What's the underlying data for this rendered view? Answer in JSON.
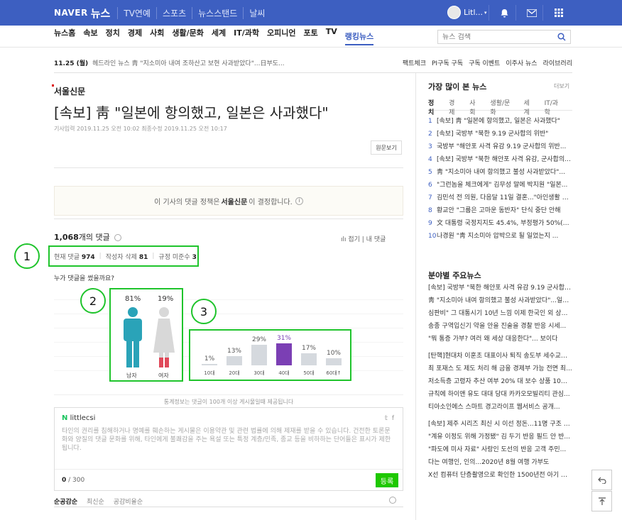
{
  "topbar": {
    "logo": "NAVER",
    "section": "뉴스",
    "links": [
      "TV연예",
      "스포츠",
      "뉴스스탠드",
      "날씨"
    ],
    "user_name": "Litl..."
  },
  "subnav": {
    "items": [
      "뉴스홈",
      "속보",
      "정치",
      "경제",
      "사회",
      "생활/문화",
      "세계",
      "IT/과학",
      "오피니언",
      "포토",
      "TV",
      "랭킹뉴스"
    ],
    "active": "랭킹뉴스",
    "search_placeholder": "뉴스 검색"
  },
  "breaking": {
    "date": "11.25 (월)",
    "text": "헤드라인 뉴스  靑 \"지소미아 내여 조하산고 보현 사과받았다\"...日부도...",
    "links": [
      "팩트체크",
      "PI구독 구독",
      "구독 이벤트",
      "이주사 뉴스",
      "라이브러리"
    ]
  },
  "article": {
    "press": "서울신문",
    "headline": "[속보] 靑 \"일본에 항의했고, 일본은 사과했다\"",
    "meta": "기사입력 2019.11.25 오전 10:02   최종수정 2019.11.25 오전 10:17",
    "origin_button": "원문보기",
    "policy_prefix": "이 기사의 댓글 정책은",
    "policy_press": "서울신문",
    "policy_suffix": "이 결정합니다."
  },
  "comments": {
    "count_number": "1,068",
    "count_suffix": "개의 댓글",
    "right_controls": "ılı 접기  |  내 댓글",
    "stat_current_label": "현재 댓글",
    "stat_current_value": "974",
    "stat_deleted_label": "작성자 삭제",
    "stat_deleted_value": "81",
    "stat_violation_label": "규정 미준수",
    "stat_violation_value": "3",
    "question": "누가 댓글을 썼을까요?",
    "notice": "통계정보는 댓글이 100개 이상 게시물일때 제공됩니다",
    "write_user": "littlecsi",
    "write_placeholder": "타인의 권리를 침해하거나 명예를 훼손하는 게시물은 이용약관 및 관련 법률에 의해 제재를 받을 수 있습니다. 건전한 토론문화와 양질의 댓글 문화를 위해, 타인에게 불쾌감을 주는 욕설 또는 특정 계층/민족, 종교 등을 비하하는 단어들은 표시가 제한됩니다.",
    "char_count": "0",
    "char_max": "/ 300",
    "submit_label": "등록",
    "sort_tabs": [
      "순공감순",
      "최신순",
      "공감비율순"
    ]
  },
  "gender": {
    "male_pct": "81%",
    "female_pct": "19%",
    "male_label": "남자",
    "female_label": "여자",
    "male_color": "#2aa3b8",
    "female_color": "#e0495a"
  },
  "age": {
    "labels": [
      "10대",
      "20대",
      "30대",
      "40대",
      "50대",
      "60대↑"
    ],
    "values": [
      1,
      13,
      29,
      31,
      17,
      10
    ],
    "max_color": "#7b3fb4"
  },
  "ranking": {
    "title": "가장 많이 본 뉴스",
    "more": "더보기",
    "tabs": [
      "정치",
      "경제",
      "사회",
      "생활/문화",
      "세계",
      "IT/과학"
    ],
    "items": [
      "[속보] 靑 \"일본에 항의했고, 일본은 사과했다\"",
      "[속보] 국방부 \"북한 9.19 군사합의 위반\"",
      "국방부 \"해안포 사격 유감 9.19 군사합의 위반...",
      "[속보] 국방부 \"북한 해안포 사격 유감, 군사합의...",
      "靑 \"지소미아 내여 항의했고 불성 사과받았다\"...",
      "\"그런놈을 체크에게\" 김무성 말에 박지원 \"일본...",
      "김민석 전 의원, 다음달 11일 결혼...\"아인생활 발...",
      "황교안 \"그룹은 고마운 동반자\" 단식 중단 안해",
      "文 대통령 국정지지도 45.4%, 부정평가 50%(리...",
      "나경원 \"靑 지소미아 압박으로 될 일었는지 ..."
    ]
  },
  "section_news": {
    "title": "분야별 주요뉴스",
    "items": [
      "[속보] 국방부 \"북한 해안포 사격 유감 9.19 군사합의...",
      "靑 \"지소미아 내여 항의했고 불성 사과받았다\"...일부...",
      "심판비\" 그 대통시기 10년 느낌 이제 한국인 외 상실...",
      "송종 구역입신기 약을 안을 진술을 경찰 반응 시세...",
      "\"뭐 통증 가부? 여러 왜 세상 대응한다\"... 보이다",
      "[탄핵]현대차 이훈초 대표이사 퇴직 송도부 세수교체...",
      "최 포재스 도 제도 처리 해 금융 경제부 가능 전면 최...",
      "저소득층 고령자 추산 여부 20% 대 보수 상품 10년 중시...",
      "규칙에 하이앤 유도 대대 당대 카카오모빌리티 관심...",
      "티아소인에스 스마트 경고라이프 웹서비스 공개...",
      "[속보] 제주 시리즈 최신 시 이선 정돈...11명 구조 1명...",
      "\"계유 이정도 위해 가정됐\" 김 두기 반응 필드 안 반...",
      "\"파도에 미사 자료\" 사랑인 도선의 반응 고객 주민...",
      "다는 여행인, 인의...2020년 8월 여행 가부도",
      "X선 컴퓨터 단층촬영으로 확인한 1500년전 아기 얼..."
    ]
  },
  "markers": [
    "1",
    "2",
    "3"
  ]
}
